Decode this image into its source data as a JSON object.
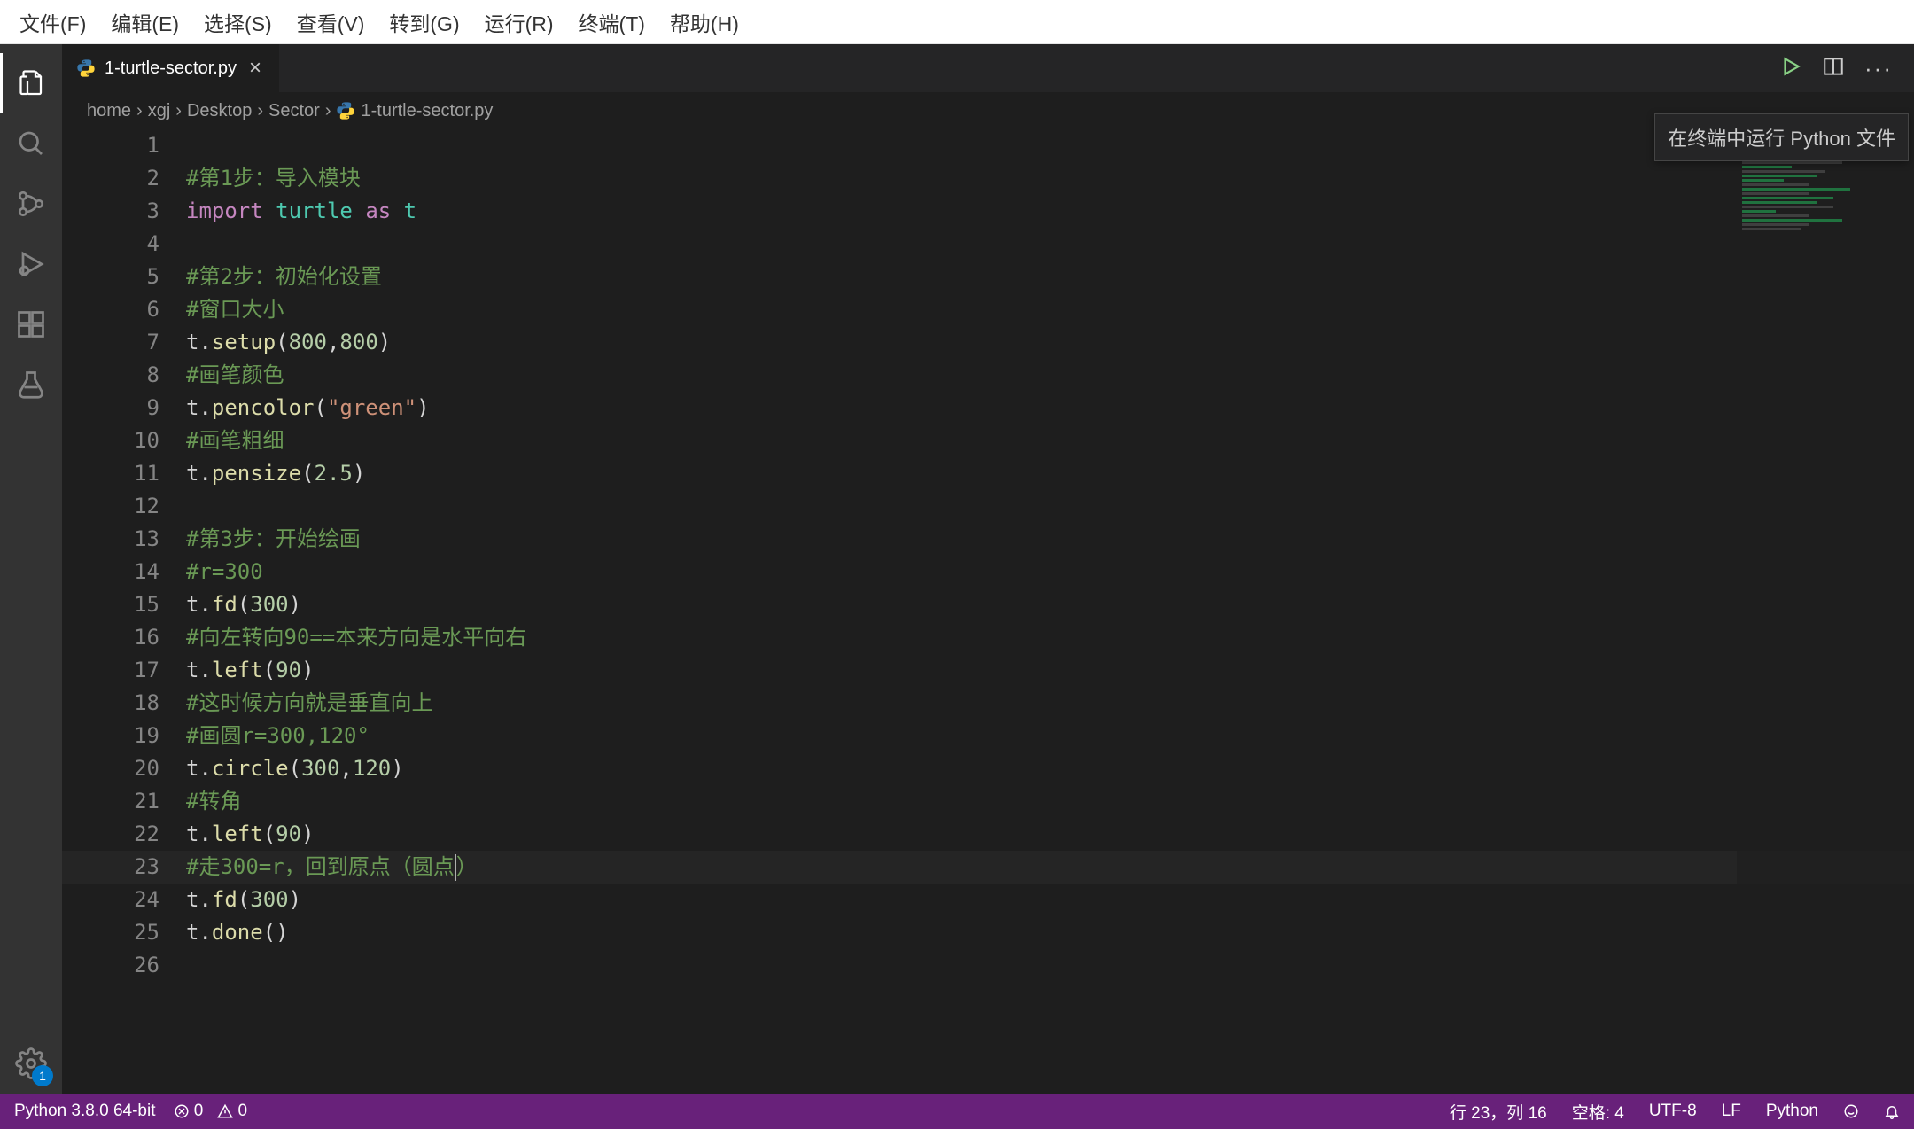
{
  "menubar": {
    "items": [
      "文件(F)",
      "编辑(E)",
      "选择(S)",
      "查看(V)",
      "转到(G)",
      "运行(R)",
      "终端(T)",
      "帮助(H)"
    ]
  },
  "activitybar": {
    "badge": "1"
  },
  "tabs": {
    "active": {
      "label": "1-turtle-sector.py"
    }
  },
  "editor_actions": {
    "run_tooltip": "在终端中运行 Python 文件"
  },
  "breadcrumbs": {
    "parts": [
      "home",
      "xgj",
      "Desktop",
      "Sector",
      "1-turtle-sector.py"
    ]
  },
  "editor": {
    "lines": [
      {
        "n": 1,
        "tokens": []
      },
      {
        "n": 2,
        "tokens": [
          {
            "t": "#第1步：导入模块",
            "c": "comment"
          }
        ]
      },
      {
        "n": 3,
        "tokens": [
          {
            "t": "import",
            "c": "kw"
          },
          {
            "t": " "
          },
          {
            "t": "turtle",
            "c": "mod"
          },
          {
            "t": " "
          },
          {
            "t": "as",
            "c": "kw"
          },
          {
            "t": " "
          },
          {
            "t": "t",
            "c": "mod"
          }
        ]
      },
      {
        "n": 4,
        "tokens": []
      },
      {
        "n": 5,
        "tokens": [
          {
            "t": "#第2步：初始化设置",
            "c": "comment"
          }
        ]
      },
      {
        "n": 6,
        "tokens": [
          {
            "t": "#窗口大小",
            "c": "comment"
          }
        ]
      },
      {
        "n": 7,
        "tokens": [
          {
            "t": "t",
            "c": "ident"
          },
          {
            "t": ".",
            "c": "punct"
          },
          {
            "t": "setup",
            "c": "func"
          },
          {
            "t": "(",
            "c": "punct"
          },
          {
            "t": "800",
            "c": "num"
          },
          {
            "t": ",",
            "c": "punct"
          },
          {
            "t": "800",
            "c": "num"
          },
          {
            "t": ")",
            "c": "punct"
          }
        ]
      },
      {
        "n": 8,
        "tokens": [
          {
            "t": "#画笔颜色",
            "c": "comment"
          }
        ]
      },
      {
        "n": 9,
        "tokens": [
          {
            "t": "t",
            "c": "ident"
          },
          {
            "t": ".",
            "c": "punct"
          },
          {
            "t": "pencolor",
            "c": "func"
          },
          {
            "t": "(",
            "c": "punct"
          },
          {
            "t": "\"green\"",
            "c": "str"
          },
          {
            "t": ")",
            "c": "punct"
          }
        ]
      },
      {
        "n": 10,
        "tokens": [
          {
            "t": "#画笔粗细",
            "c": "comment"
          }
        ]
      },
      {
        "n": 11,
        "tokens": [
          {
            "t": "t",
            "c": "ident"
          },
          {
            "t": ".",
            "c": "punct"
          },
          {
            "t": "pensize",
            "c": "func"
          },
          {
            "t": "(",
            "c": "punct"
          },
          {
            "t": "2.5",
            "c": "num"
          },
          {
            "t": ")",
            "c": "punct"
          }
        ]
      },
      {
        "n": 12,
        "tokens": []
      },
      {
        "n": 13,
        "tokens": [
          {
            "t": "#第3步：开始绘画",
            "c": "comment"
          }
        ]
      },
      {
        "n": 14,
        "tokens": [
          {
            "t": "#r=300",
            "c": "comment"
          }
        ]
      },
      {
        "n": 15,
        "tokens": [
          {
            "t": "t",
            "c": "ident"
          },
          {
            "t": ".",
            "c": "punct"
          },
          {
            "t": "fd",
            "c": "func"
          },
          {
            "t": "(",
            "c": "punct"
          },
          {
            "t": "300",
            "c": "num"
          },
          {
            "t": ")",
            "c": "punct"
          }
        ]
      },
      {
        "n": 16,
        "tokens": [
          {
            "t": "#向左转向90==本来方向是水平向右",
            "c": "comment"
          }
        ]
      },
      {
        "n": 17,
        "tokens": [
          {
            "t": "t",
            "c": "ident"
          },
          {
            "t": ".",
            "c": "punct"
          },
          {
            "t": "left",
            "c": "func"
          },
          {
            "t": "(",
            "c": "punct"
          },
          {
            "t": "90",
            "c": "num"
          },
          {
            "t": ")",
            "c": "punct"
          }
        ]
      },
      {
        "n": 18,
        "tokens": [
          {
            "t": "#这时候方向就是垂直向上",
            "c": "comment"
          }
        ]
      },
      {
        "n": 19,
        "tokens": [
          {
            "t": "#画圆r=300,120°",
            "c": "comment"
          }
        ]
      },
      {
        "n": 20,
        "tokens": [
          {
            "t": "t",
            "c": "ident"
          },
          {
            "t": ".",
            "c": "punct"
          },
          {
            "t": "circle",
            "c": "func"
          },
          {
            "t": "(",
            "c": "punct"
          },
          {
            "t": "300",
            "c": "num"
          },
          {
            "t": ",",
            "c": "punct"
          },
          {
            "t": "120",
            "c": "num"
          },
          {
            "t": ")",
            "c": "punct"
          }
        ]
      },
      {
        "n": 21,
        "tokens": [
          {
            "t": "#转角",
            "c": "comment"
          }
        ]
      },
      {
        "n": 22,
        "tokens": [
          {
            "t": "t",
            "c": "ident"
          },
          {
            "t": ".",
            "c": "punct"
          },
          {
            "t": "left",
            "c": "func"
          },
          {
            "t": "(",
            "c": "punct"
          },
          {
            "t": "90",
            "c": "num"
          },
          {
            "t": ")",
            "c": "punct"
          }
        ]
      },
      {
        "n": 23,
        "current": true,
        "tokens": [
          {
            "t": "#走300=r，回到原点（圆点",
            "c": "comment"
          },
          {
            "t": "",
            "cursor": true
          },
          {
            "t": "）",
            "c": "comment"
          }
        ]
      },
      {
        "n": 24,
        "tokens": [
          {
            "t": "t",
            "c": "ident"
          },
          {
            "t": ".",
            "c": "punct"
          },
          {
            "t": "fd",
            "c": "func"
          },
          {
            "t": "(",
            "c": "punct"
          },
          {
            "t": "300",
            "c": "num"
          },
          {
            "t": ")",
            "c": "punct"
          }
        ]
      },
      {
        "n": 25,
        "tokens": [
          {
            "t": "t",
            "c": "ident"
          },
          {
            "t": ".",
            "c": "punct"
          },
          {
            "t": "done",
            "c": "func"
          },
          {
            "t": "()",
            "c": "punct"
          }
        ]
      },
      {
        "n": 26,
        "tokens": []
      }
    ]
  },
  "statusbar": {
    "python": "Python 3.8.0 64-bit",
    "errors": "0",
    "warnings": "0",
    "cursor": "行 23，列 16",
    "indent": "空格: 4",
    "encoding": "UTF-8",
    "eol": "LF",
    "language": "Python"
  }
}
